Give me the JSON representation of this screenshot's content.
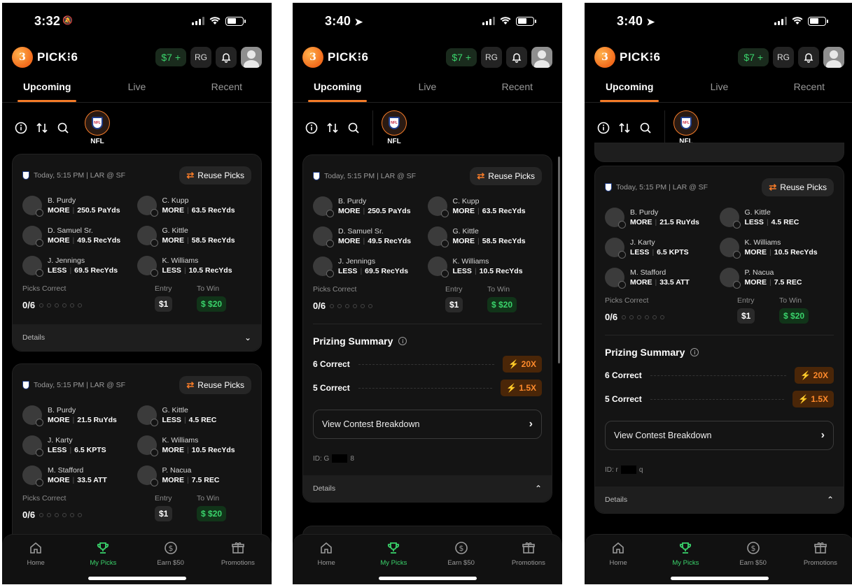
{
  "app": {
    "logo_mark": "3",
    "logo_text": "PICK⁝6",
    "balance": "$7 +",
    "rg_label": "RG"
  },
  "tabs": [
    "Upcoming",
    "Live",
    "Recent"
  ],
  "league": "NFL",
  "game_info": "Today, 5:15 PM | LAR @ SF",
  "reuse_label": "Reuse Picks",
  "picks_correct_label": "Picks Correct",
  "picks_correct_value": "0/6",
  "entry_label": "Entry",
  "entry_value": "$1",
  "to_win_label": "To Win",
  "to_win_value": "$20",
  "details_label": "Details",
  "prizing": {
    "title": "Prizing Summary",
    "rows": [
      {
        "label": "6 Correct",
        "mult": "20X"
      },
      {
        "label": "5 Correct",
        "mult": "1.5X"
      }
    ],
    "breakdown": "View Contest Breakdown"
  },
  "entry_a": [
    {
      "name": "B. Purdy",
      "dir": "MORE",
      "line": "250.5 PaYds"
    },
    {
      "name": "C. Kupp",
      "dir": "MORE",
      "line": "63.5 RecYds"
    },
    {
      "name": "D. Samuel Sr.",
      "dir": "MORE",
      "line": "49.5 RecYds"
    },
    {
      "name": "G. Kittle",
      "dir": "MORE",
      "line": "58.5 RecYds"
    },
    {
      "name": "J. Jennings",
      "dir": "LESS",
      "line": "69.5 RecYds"
    },
    {
      "name": "K. Williams",
      "dir": "LESS",
      "line": "10.5 RecYds"
    }
  ],
  "entry_b": [
    {
      "name": "B. Purdy",
      "dir": "MORE",
      "line": "21.5 RuYds"
    },
    {
      "name": "G. Kittle",
      "dir": "LESS",
      "line": "4.5 REC"
    },
    {
      "name": "J. Karty",
      "dir": "LESS",
      "line": "6.5 KPTS"
    },
    {
      "name": "K. Williams",
      "dir": "MORE",
      "line": "10.5 RecYds"
    },
    {
      "name": "M. Stafford",
      "dir": "MORE",
      "line": "33.5 ATT"
    },
    {
      "name": "P. Nacua",
      "dir": "MORE",
      "line": "7.5 REC"
    }
  ],
  "nav": [
    "Home",
    "My Picks",
    "Earn $50",
    "Promotions"
  ],
  "screens": [
    {
      "time": "3:32",
      "id_prefix": "",
      "id_suffix": ""
    },
    {
      "time": "3:40",
      "id_prefix": "ID: G",
      "id_suffix": "8"
    },
    {
      "time": "3:40",
      "id_prefix": "ID: r",
      "id_suffix": "q"
    }
  ]
}
